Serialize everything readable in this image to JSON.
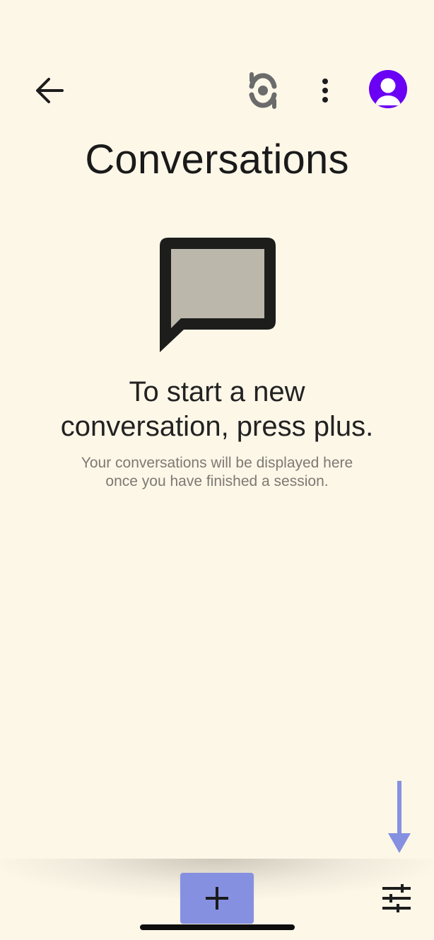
{
  "header": {
    "back_icon": "arrow-left-icon",
    "sync_icon": "sync-icon",
    "more_icon": "more-vertical-icon",
    "avatar_icon": "account-avatar-icon"
  },
  "page": {
    "title": "Conversations"
  },
  "empty_state": {
    "icon": "chat-bubble-icon",
    "headline_line1": "To start a new",
    "headline_line2": "conversation, press plus.",
    "sub_line1": "Your conversations will be displayed here",
    "sub_line2": "once you have finished a session."
  },
  "bottom_bar": {
    "add_icon": "plus-icon",
    "filter_icon": "tune-sliders-icon",
    "hint_icon": "down-arrow-hint-icon"
  },
  "colors": {
    "background": "#fdf7e8",
    "accent": "#8690e1",
    "avatar": "#6a00f4",
    "text_primary": "#1a1a1a",
    "text_secondary": "#7d7972",
    "bubble_fill": "#bcb7ab"
  }
}
